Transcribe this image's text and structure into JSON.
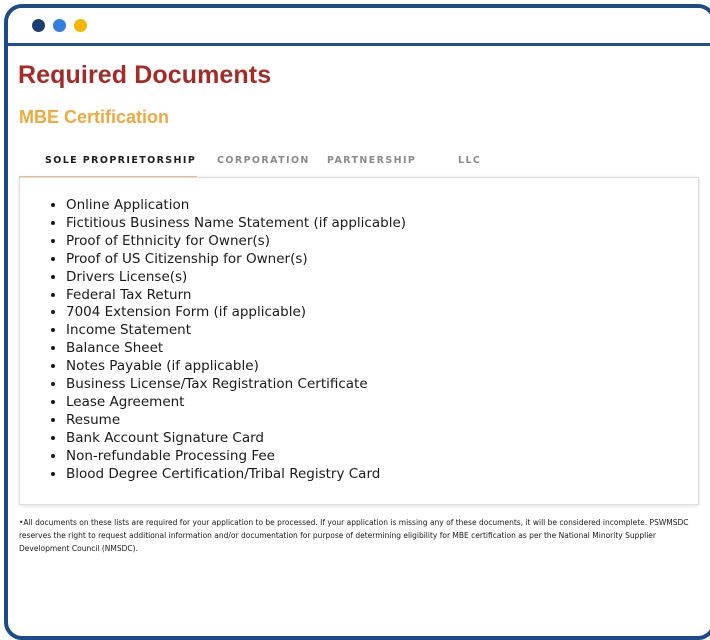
{
  "window": {
    "controls": [
      "close",
      "minimize",
      "maximize"
    ],
    "control_colors": [
      "#1c3f73",
      "#2f7ee0",
      "#f6b600"
    ]
  },
  "page_title": "Required Documents",
  "subtitle": "MBE Certification",
  "tabs": [
    {
      "label": "SOLE PROPRIETORSHIP",
      "active": true
    },
    {
      "label": "CORPORATION",
      "active": false
    },
    {
      "label": "PARTNERSHIP",
      "active": false
    },
    {
      "label": "LLC",
      "active": false
    }
  ],
  "documents": [
    "Online Application",
    "Fictitious Business Name Statement (if applicable)",
    "Proof of Ethnicity for Owner(s)",
    "Proof of US Citizenship for Owner(s)",
    "Drivers License(s)",
    "Federal Tax Return",
    "7004 Extension Form (if applicable)",
    "Income Statement",
    "Balance Sheet",
    "Notes Payable (if applicable)",
    "Business License/Tax Registration Certificate",
    "Lease Agreement",
    "Resume",
    "Bank Account Signature Card",
    "Non-refundable Processing Fee",
    "Blood Degree Certification/Tribal Registry Card"
  ],
  "footnote": "•All documents on these lists are required for your application to be processed. If your application is missing any of these documents, it will be considered incomplete. PSWMSDC reserves the right to request additional information and/or documentation for purpose of determining eligibility for MBE certification as per the National Minority Supplier Development Council (NMSDC).",
  "colors": {
    "title": "#a52b27",
    "subtitle": "#f0a93c",
    "frame": "#1a4a8a",
    "active_tab_underline": "#f2c48b"
  }
}
